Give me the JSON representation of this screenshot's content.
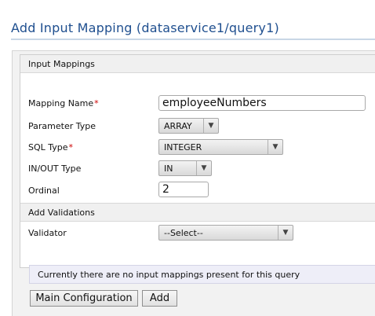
{
  "page": {
    "title": "Add Input Mapping (dataservice1/query1)"
  },
  "input_mappings": {
    "section_title": "Input Mappings",
    "mapping_name": {
      "label": "Mapping Name",
      "required_mark": "*",
      "value": "employeeNumbers"
    },
    "parameter_type": {
      "label": "Parameter Type",
      "value": "ARRAY"
    },
    "sql_type": {
      "label": "SQL Type",
      "required_mark": "*",
      "value": "INTEGER"
    },
    "in_out_type": {
      "label": "IN/OUT Type",
      "value": "IN"
    },
    "ordinal": {
      "label": "Ordinal",
      "value": "2"
    }
  },
  "validations": {
    "section_title": "Add Validations",
    "validator": {
      "label": "Validator",
      "value": "--Select--"
    }
  },
  "notice": "Currently there are no input mappings present for this query",
  "buttons": {
    "main_configuration": "Main Configuration",
    "add": "Add"
  },
  "icons": {
    "dropdown_arrow": "chevron-down-icon"
  },
  "colors": {
    "title": "#1f4f8f",
    "required": "#cc0000"
  }
}
